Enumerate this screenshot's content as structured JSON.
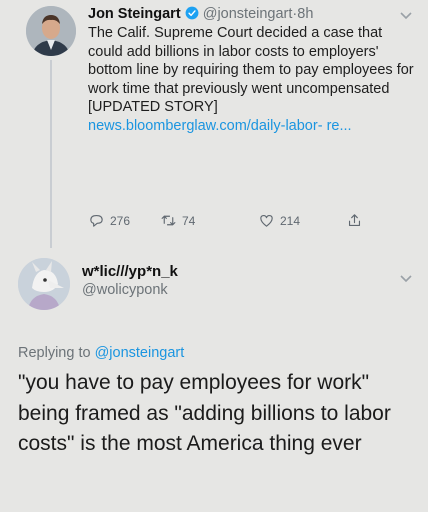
{
  "tweet1": {
    "name": "Jon Steingart",
    "handle": "@jonsteingart",
    "separator": "·",
    "time": "8h",
    "text": "The Calif. Supreme Court decided a case that could add billions in labor costs to employers' bottom line by requiring them to pay employees for work time that previously went uncompensated [UPDATED STORY]",
    "link_line1": "news.bloomberglaw.com/daily-labor-",
    "link_line2": "re...",
    "replies": "276",
    "retweets": "74",
    "likes": "214"
  },
  "tweet2": {
    "name": "w*lic///yp*n_k",
    "handle": "@wolicyponk",
    "replying_prefix": "Replying to",
    "replying_to": "@jonsteingart",
    "text": "\"you have to pay employees for work\" being framed as \"adding billions to labor costs\" is the most America thing ever"
  },
  "colors": {
    "background": "#e6e6e4",
    "link": "#1b95e0",
    "muted": "#6c7378",
    "verified": "#1da1f2"
  },
  "icons": [
    "verified-badge-icon",
    "chevron-down-icon",
    "reply-icon",
    "retweet-icon",
    "like-icon",
    "share-icon"
  ]
}
